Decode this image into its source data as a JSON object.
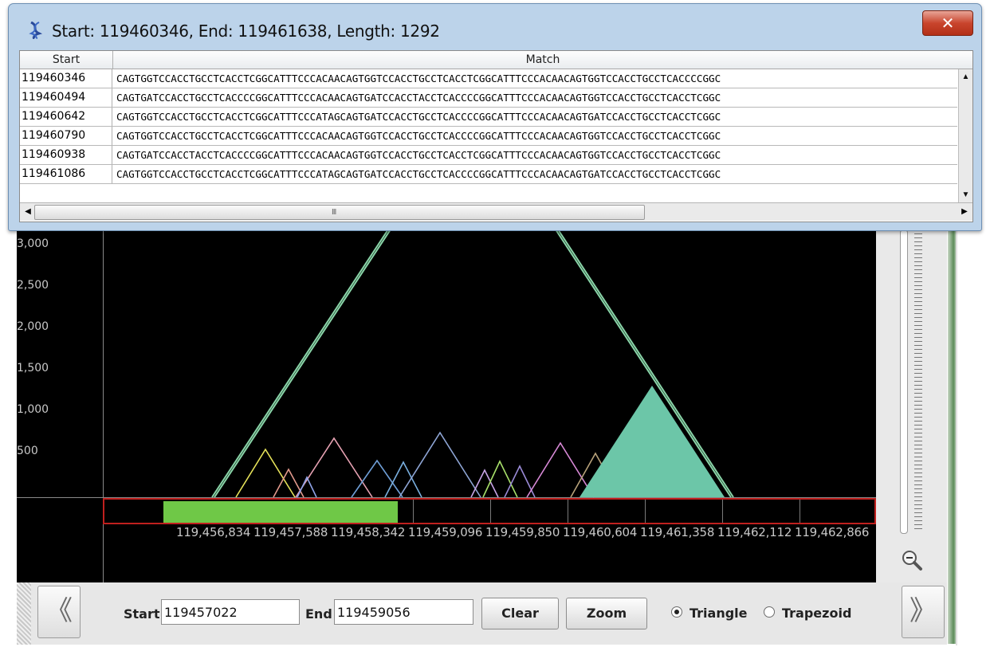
{
  "window": {
    "title": "Start: 119460346, End: 119461638, Length: 1292",
    "close_label": "✕",
    "icon": "dna-icon"
  },
  "table": {
    "columns": [
      "Start",
      "Match"
    ],
    "rows": [
      {
        "start": "119460346",
        "match": "CAGTGGTCCACCTGCCTCACCTCGGCATTTCCCACAACAGTGGTCCACCTGCCTCACCTCGGCATTTCCCACAACAGTGGTCCACCTGCCTCACCCCGGC"
      },
      {
        "start": "119460494",
        "match": "CAGTGATCCACCTGCCTCACCCCGGCATTTCCCACAACAGTGATCCACCTACCTCACCCCGGCATTTCCCACAACAGTGGTCCACCTGCCTCACCTCGGC"
      },
      {
        "start": "119460642",
        "match": "CAGTGGTCCACCTGCCTCACCTCGGCATTTCCCATAGCAGTGATCCACCTGCCTCACCCCGGCATTTCCCACAACAGTGATCCACCTGCCTCACCTCGGC"
      },
      {
        "start": "119460790",
        "match": "CAGTGGTCCACCTGCCTCACCTCGGCATTTCCCACAACAGTGGTCCACCTGCCTCACCCCGGCATTTCCCACAACAGTGGTCCACCTGCCTCACCTCGGC"
      },
      {
        "start": "119460938",
        "match": "CAGTGATCCACCTACCTCACCCCGGCATTTCCCACAACAGTGGTCCACCTGCCTCACCTCGGCATTTCCCACAACAGTGGTCCACCTGCCTCACCTCGGC"
      },
      {
        "start": "119461086",
        "match": "CAGTGGTCCACCTGCCTCACCTCGGCATTTCCCATAGCAGTGATCCACCTGCCTCACCCCGGCATTTCCCACAACAGTGATCCACCTGCCTCACCTCGGC"
      }
    ],
    "scroll_up": "▲",
    "scroll_down": "▼",
    "scroll_left": "◀",
    "scroll_right": "▶",
    "thumb_grip": "III"
  },
  "plot": {
    "y_labels": [
      "3,000",
      "2,500",
      "2,000",
      "1,500",
      "1,000",
      "500"
    ],
    "x_labels": [
      "119,456,834",
      "119,457,588",
      "119,458,342",
      "119,459,096",
      "119,459,850",
      "119,460,604",
      "119,461,358",
      "119,462,112",
      "119,462,866"
    ],
    "selection_color": "#6fc847",
    "ruler_border_color": "#c0201e",
    "highlight_color": "#6cc6a8"
  },
  "zoom": {
    "icon": "zoom-out-icon"
  },
  "toolbar": {
    "prev_label": "《",
    "next_label": "》",
    "start_label": "Start",
    "start_value": "119457022",
    "end_label": "End",
    "end_value": "119459056",
    "clear_label": "Clear",
    "zoom_label": "Zoom",
    "triangle_label": "Triangle",
    "trapezoid_label": "Trapezoid",
    "selected_shape": "Triangle"
  }
}
